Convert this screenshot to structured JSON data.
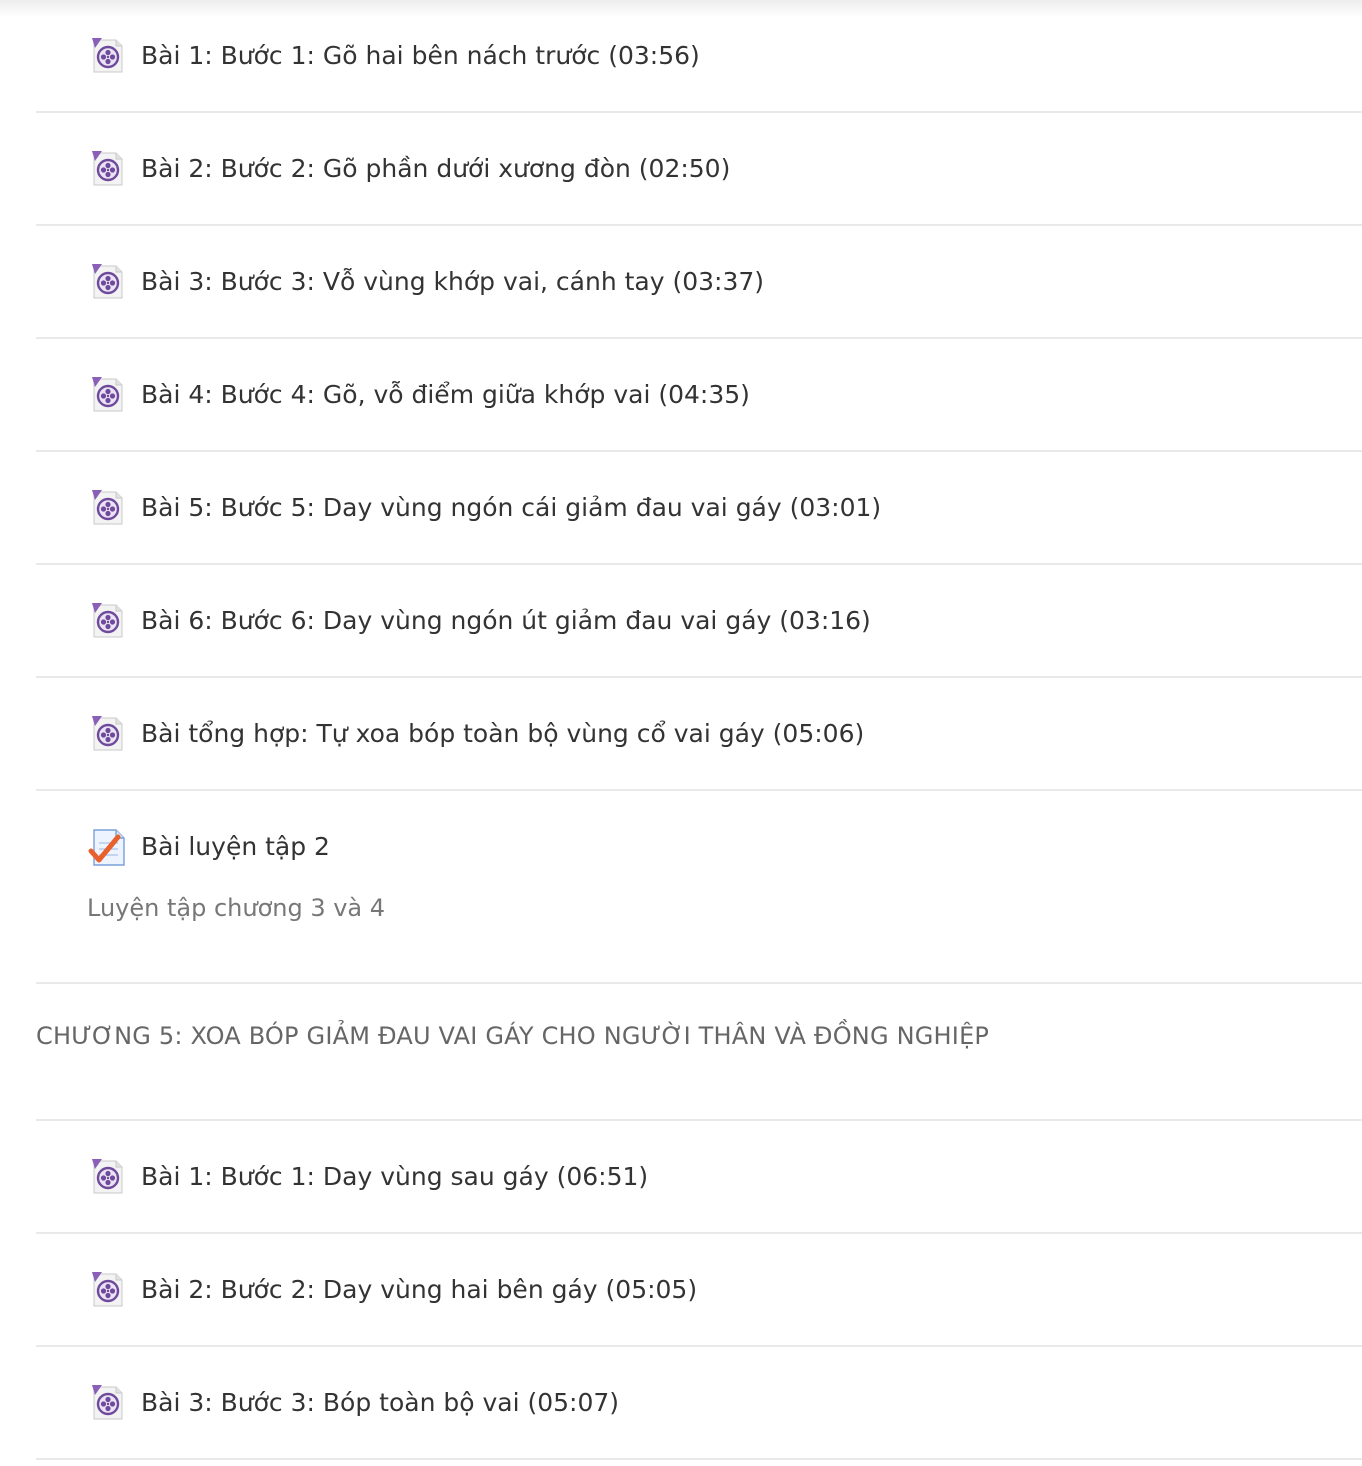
{
  "section4": {
    "lessons": [
      {
        "label": "Bài 1: Bước 1: Gõ hai bên nách trước (03:56)",
        "icon": "video-lesson-icon"
      },
      {
        "label": "Bài 2: Bước 2: Gõ phần dưới xương đòn (02:50)",
        "icon": "video-lesson-icon"
      },
      {
        "label": "Bài 3: Bước 3: Vỗ vùng khớp vai, cánh tay (03:37)",
        "icon": "video-lesson-icon"
      },
      {
        "label": "Bài 4: Bước 4: Gõ, vỗ điểm giữa khớp vai (04:35)",
        "icon": "video-lesson-icon"
      },
      {
        "label": "Bài 5: Bước 5: Day vùng ngón cái giảm đau vai gáy (03:01)",
        "icon": "video-lesson-icon"
      },
      {
        "label": "Bài 6: Bước 6: Day vùng ngón út giảm đau vai gáy (03:16)",
        "icon": "video-lesson-icon"
      },
      {
        "label": "Bài tổng hợp: Tự xoa bóp toàn bộ vùng cổ vai gáy (05:06)",
        "icon": "video-lesson-icon"
      }
    ],
    "quiz": {
      "label": "Bài luyện tập 2",
      "description": "Luyện tập chương 3 và 4",
      "icon": "quiz-checkmark-icon"
    }
  },
  "section5": {
    "title": "CHƯƠNG 5: XOA BÓP GIẢM ĐAU VAI GÁY CHO NGƯỜI THÂN VÀ ĐỒNG NGHIỆP",
    "lessons": [
      {
        "label": "Bài 1: Bước 1: Day vùng sau gáy (06:51)",
        "icon": "video-lesson-icon"
      },
      {
        "label": "Bài 2: Bước 2: Day vùng hai bên gáy (05:05)",
        "icon": "video-lesson-icon"
      },
      {
        "label": "Bài 3: Bước 3: Bóp toàn bộ vai (05:07)",
        "icon": "video-lesson-icon"
      }
    ]
  },
  "colors": {
    "text": "#333333",
    "section_title": "#666666",
    "description": "#777777",
    "divider": "#e9e9e9",
    "icon_purple": "#6f4a9c",
    "quiz_check": "#e8612c"
  }
}
